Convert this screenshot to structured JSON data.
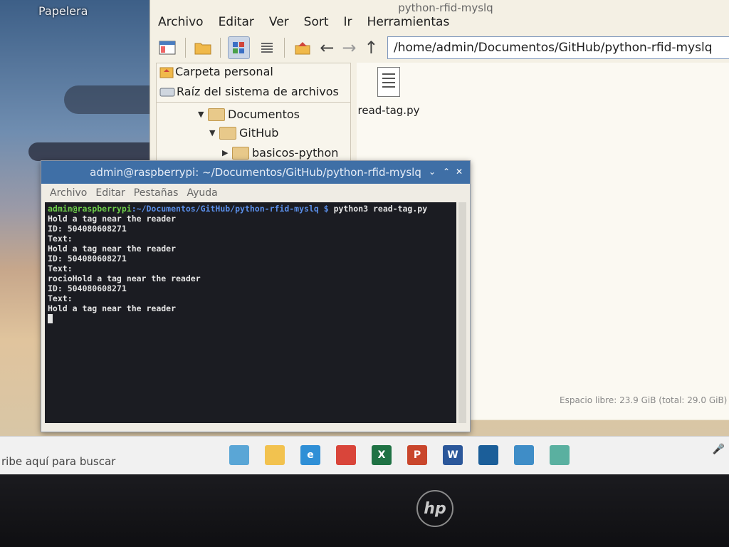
{
  "desktop": {
    "trash_label": "Papelera"
  },
  "file_manager": {
    "title": "python-rfid-myslq",
    "menu": [
      "Archivo",
      "Editar",
      "Ver",
      "Sort",
      "Ir",
      "Herramientas"
    ],
    "path": "/home/admin/Documentos/GitHub/python-rfid-myslq",
    "places": [
      "Carpeta personal",
      "Raíz del sistema de archivos"
    ],
    "tree": [
      "Documentos",
      "GitHub",
      "basicos-python"
    ],
    "files": [
      {
        "name": "read-tag.py",
        "icon": "python-file-icon"
      }
    ],
    "status": "Espacio libre: 23.9 GiB (total: 29.0 GiB)"
  },
  "terminal": {
    "title": "admin@raspberrypi: ~/Documentos/GitHub/python-rfid-myslq",
    "menu": [
      "Archivo",
      "Editar",
      "Pestañas",
      "Ayuda"
    ],
    "prompt_user": "admin@raspberrypi",
    "prompt_path": ":~/Documentos/GitHub/python-rfid-myslq $",
    "command": " python3 read-tag.py",
    "lines": [
      "Hold a tag near the reader",
      "ID: 504080608271",
      "Text:",
      "Hold a tag near the reader",
      "ID: 504080608271",
      "Text:",
      "rocioHold a tag near the reader",
      "",
      "ID: 504080608271",
      "Text:",
      "Hold a tag near the reader"
    ]
  },
  "taskbar": {
    "search_placeholder": "ribe aquí para buscar",
    "apps": [
      {
        "name": "task-view",
        "color": "#5aa6d6",
        "glyph": ""
      },
      {
        "name": "file-explorer",
        "color": "#f2c24f",
        "glyph": ""
      },
      {
        "name": "edge",
        "color": "#2f8fd6",
        "glyph": "e"
      },
      {
        "name": "chrome",
        "color": "#d9453a",
        "glyph": ""
      },
      {
        "name": "excel",
        "color": "#1f7244",
        "glyph": "X"
      },
      {
        "name": "powerpoint",
        "color": "#c9462c",
        "glyph": "P"
      },
      {
        "name": "word",
        "color": "#2b579a",
        "glyph": "W"
      },
      {
        "name": "virtualbox",
        "color": "#1b5e99",
        "glyph": ""
      },
      {
        "name": "paint",
        "color": "#3f8dc7",
        "glyph": ""
      },
      {
        "name": "other",
        "color": "#5ab0a0",
        "glyph": ""
      }
    ]
  },
  "bezel": {
    "logo_text": "hp"
  }
}
